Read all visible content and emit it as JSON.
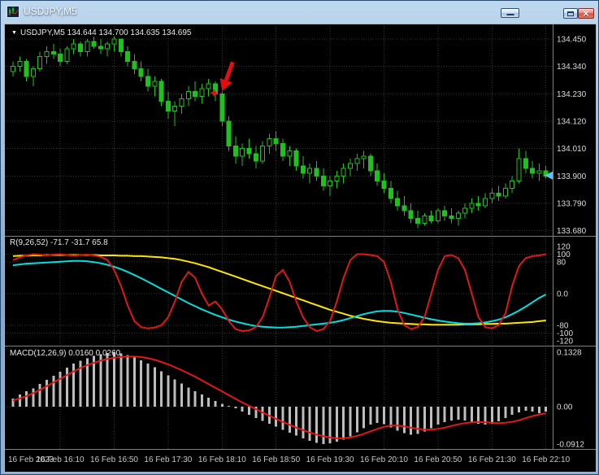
{
  "window": {
    "title": "USDJPY,M5"
  },
  "icons": {
    "close": "×",
    "dropdown": "▼"
  },
  "info": {
    "symbol": "USDJPY,M5",
    "ohlc": "134.644 134.700 134.635 134.695"
  },
  "indicators": {
    "middle_label": "R(9,26,52) -71.7 -31.7 65.8",
    "macd_label": "MACD(12,26,9) 0.0160 0.0260"
  },
  "axes": {
    "price": [
      "134.450",
      "134.340",
      "134.230",
      "134.120",
      "134.010",
      "133.900",
      "133.790",
      "133.680"
    ],
    "time": [
      "16 Feb 2023",
      "16 Feb 16:10",
      "16 Feb 16:50",
      "16 Feb 17:30",
      "16 Feb 18:10",
      "16 Feb 18:50",
      "16 Feb 19:30",
      "16 Feb 20:10",
      "16 Feb 20:50",
      "16 Feb 21:30",
      "16 Feb 22:10"
    ]
  },
  "colors": {
    "background": "#000000",
    "grid": "#383838",
    "divider": "#808080",
    "candle": "#20c020",
    "bull_body": "#000000",
    "red": "#e21717",
    "cyan": "#00dede",
    "yellow": "#ffe400",
    "histogram": "#bdbdbd",
    "axis_text": "#dcdcdc",
    "time_text": "#c8c8c8",
    "arrow": "#e01010",
    "price_marker": "#56c7f0"
  },
  "annotations": {
    "sell_arrow": {
      "bar": 31,
      "price": 134.24
    },
    "price_pointer": {
      "price": 133.902
    }
  },
  "chart_data": [
    {
      "type": "candlestick",
      "title": "USDJPY M5",
      "ylim": [
        133.66,
        134.49
      ],
      "ohlc": [
        [
          134.32,
          134.36,
          134.3,
          134.34
        ],
        [
          134.34,
          134.38,
          134.32,
          134.36
        ],
        [
          134.36,
          134.37,
          134.28,
          134.3
        ],
        [
          134.3,
          134.34,
          134.26,
          134.33
        ],
        [
          134.33,
          134.4,
          134.32,
          134.38
        ],
        [
          134.38,
          134.42,
          134.35,
          134.4
        ],
        [
          134.4,
          134.43,
          134.37,
          134.39
        ],
        [
          134.39,
          134.41,
          134.34,
          134.36
        ],
        [
          134.36,
          134.42,
          134.35,
          134.41
        ],
        [
          134.41,
          134.45,
          134.39,
          134.43
        ],
        [
          134.43,
          134.44,
          134.38,
          134.4
        ],
        [
          134.4,
          134.45,
          134.38,
          134.44
        ],
        [
          134.44,
          134.46,
          134.41,
          134.42
        ],
        [
          134.42,
          134.45,
          134.39,
          134.41
        ],
        [
          134.41,
          134.44,
          134.38,
          134.43
        ],
        [
          134.43,
          134.46,
          134.4,
          134.45
        ],
        [
          134.45,
          134.45,
          134.38,
          134.4
        ],
        [
          134.4,
          134.42,
          134.34,
          134.36
        ],
        [
          134.36,
          134.39,
          134.31,
          134.33
        ],
        [
          134.33,
          134.36,
          134.28,
          134.3
        ],
        [
          134.3,
          134.33,
          134.24,
          134.26
        ],
        [
          134.26,
          134.3,
          134.22,
          134.28
        ],
        [
          134.28,
          134.29,
          134.18,
          134.2
        ],
        [
          134.2,
          134.24,
          134.13,
          134.16
        ],
        [
          134.16,
          134.2,
          134.1,
          134.18
        ],
        [
          134.18,
          134.23,
          134.15,
          134.21
        ],
        [
          134.21,
          134.26,
          134.18,
          134.24
        ],
        [
          134.24,
          134.28,
          134.2,
          134.22
        ],
        [
          134.22,
          134.27,
          134.19,
          134.25
        ],
        [
          134.25,
          134.29,
          134.22,
          134.27
        ],
        [
          134.27,
          134.28,
          134.2,
          134.23
        ],
        [
          134.23,
          134.24,
          134.1,
          134.12
        ],
        [
          134.12,
          134.14,
          134.0,
          134.02
        ],
        [
          134.02,
          134.06,
          133.95,
          133.98
        ],
        [
          133.98,
          134.03,
          133.94,
          134.01
        ],
        [
          134.01,
          134.05,
          133.97,
          133.99
        ],
        [
          133.99,
          134.02,
          133.93,
          133.96
        ],
        [
          133.96,
          134.04,
          133.95,
          134.02
        ],
        [
          134.02,
          134.07,
          133.99,
          134.05
        ],
        [
          134.05,
          134.08,
          134.0,
          134.03
        ],
        [
          134.03,
          134.05,
          133.96,
          133.98
        ],
        [
          133.98,
          134.02,
          133.94,
          134.0
        ],
        [
          134.0,
          134.01,
          133.92,
          133.94
        ],
        [
          133.94,
          133.98,
          133.89,
          133.91
        ],
        [
          133.91,
          133.95,
          133.87,
          133.93
        ],
        [
          133.93,
          133.96,
          133.88,
          133.9
        ],
        [
          133.9,
          133.93,
          133.84,
          133.86
        ],
        [
          133.86,
          133.9,
          133.82,
          133.88
        ],
        [
          133.88,
          133.92,
          133.85,
          133.9
        ],
        [
          133.9,
          133.95,
          133.87,
          133.93
        ],
        [
          133.93,
          133.97,
          133.9,
          133.95
        ],
        [
          133.95,
          133.99,
          133.92,
          133.97
        ],
        [
          133.97,
          134.0,
          133.93,
          133.98
        ],
        [
          133.98,
          133.99,
          133.9,
          133.92
        ],
        [
          133.92,
          133.95,
          133.86,
          133.88
        ],
        [
          133.88,
          133.91,
          133.83,
          133.85
        ],
        [
          133.85,
          133.88,
          133.79,
          133.81
        ],
        [
          133.81,
          133.84,
          133.76,
          133.78
        ],
        [
          133.78,
          133.82,
          133.74,
          133.76
        ],
        [
          133.76,
          133.79,
          133.71,
          133.73
        ],
        [
          133.73,
          133.76,
          133.69,
          133.71
        ],
        [
          133.71,
          133.75,
          133.7,
          133.74
        ],
        [
          133.74,
          133.76,
          133.71,
          133.72
        ],
        [
          133.72,
          133.77,
          133.71,
          133.76
        ],
        [
          133.76,
          133.78,
          133.72,
          133.74
        ],
        [
          133.74,
          133.77,
          133.71,
          133.73
        ],
        [
          133.73,
          133.76,
          133.7,
          133.75
        ],
        [
          133.75,
          133.79,
          133.73,
          133.77
        ],
        [
          133.77,
          133.81,
          133.75,
          133.79
        ],
        [
          133.79,
          133.82,
          133.76,
          133.78
        ],
        [
          133.78,
          133.83,
          133.77,
          133.81
        ],
        [
          133.81,
          133.85,
          133.79,
          133.83
        ],
        [
          133.83,
          133.86,
          133.8,
          133.82
        ],
        [
          133.82,
          133.87,
          133.81,
          133.85
        ],
        [
          133.85,
          133.9,
          133.83,
          133.88
        ],
        [
          133.88,
          134.01,
          133.87,
          133.97
        ],
        [
          133.97,
          134.0,
          133.91,
          133.93
        ],
        [
          133.93,
          133.96,
          133.89,
          133.91
        ],
        [
          133.91,
          133.95,
          133.88,
          133.92
        ],
        [
          133.92,
          133.94,
          133.89,
          133.9
        ]
      ]
    },
    {
      "type": "line",
      "name": "R(9,26,52)",
      "ylim": [
        -130,
        130
      ],
      "grid": [
        100,
        80,
        0,
        -80,
        -100
      ],
      "axis": [
        "120",
        "100",
        "80",
        "0.0",
        "-80",
        "-100",
        "-120"
      ],
      "series": [
        {
          "name": "red",
          "values": [
            85,
            92,
            97,
            100,
            99,
            97,
            99,
            100,
            98,
            96,
            98,
            99,
            97,
            93,
            85,
            60,
            20,
            -30,
            -70,
            -85,
            -88,
            -86,
            -80,
            -60,
            -20,
            30,
            55,
            40,
            0,
            -30,
            -20,
            -40,
            -70,
            -90,
            -95,
            -93,
            -85,
            -60,
            -10,
            45,
            60,
            30,
            -20,
            -60,
            -85,
            -95,
            -90,
            -70,
            -20,
            40,
            85,
            100,
            100,
            98,
            95,
            80,
            30,
            -40,
            -80,
            -90,
            -85,
            -60,
            0,
            60,
            95,
            98,
            90,
            60,
            0,
            -60,
            -85,
            -88,
            -80,
            -50,
            20,
            70,
            90,
            95,
            97,
            100
          ]
        },
        {
          "name": "cyan",
          "values": [
            72,
            74,
            76,
            77,
            78,
            79,
            80,
            81,
            82,
            83,
            83,
            82,
            80,
            77,
            73,
            68,
            62,
            55,
            47,
            39,
            30,
            21,
            12,
            3,
            -6,
            -15,
            -24,
            -32,
            -40,
            -47,
            -54,
            -60,
            -66,
            -71,
            -75,
            -79,
            -82,
            -84,
            -85,
            -86,
            -86,
            -85,
            -84,
            -82,
            -80,
            -78,
            -76,
            -74,
            -71,
            -67,
            -62,
            -57,
            -52,
            -48,
            -45,
            -44,
            -44,
            -46,
            -49,
            -53,
            -57,
            -61,
            -65,
            -68,
            -71,
            -73,
            -75,
            -76,
            -76,
            -75,
            -73,
            -70,
            -66,
            -60,
            -52,
            -43,
            -33,
            -22,
            -11,
            -2
          ]
        },
        {
          "name": "yellow",
          "values": [
            95,
            96,
            96,
            97,
            97,
            98,
            98,
            98,
            98,
            98,
            98,
            98,
            98,
            97,
            97,
            97,
            96,
            96,
            95,
            95,
            94,
            93,
            92,
            90,
            88,
            85,
            81,
            77,
            72,
            67,
            61,
            55,
            49,
            43,
            37,
            31,
            25,
            19,
            13,
            7,
            1,
            -5,
            -11,
            -17,
            -23,
            -29,
            -35,
            -41,
            -46,
            -51,
            -56,
            -60,
            -64,
            -67,
            -70,
            -72,
            -74,
            -75,
            -76,
            -77,
            -78,
            -78,
            -79,
            -79,
            -79,
            -79,
            -79,
            -78,
            -78,
            -78,
            -77,
            -77,
            -76,
            -76,
            -75,
            -74,
            -73,
            -72,
            -70,
            -68
          ]
        }
      ]
    },
    {
      "type": "bar",
      "name": "MACD(12,26,9)",
      "ylim": [
        -0.105,
        0.145
      ],
      "axis": [
        "0.1328",
        "0.00",
        "-0.0912"
      ],
      "histogram": [
        0.02,
        0.03,
        0.038,
        0.045,
        0.055,
        0.065,
        0.075,
        0.085,
        0.095,
        0.105,
        0.112,
        0.118,
        0.124,
        0.128,
        0.131,
        0.133,
        0.13,
        0.126,
        0.12,
        0.113,
        0.105,
        0.096,
        0.086,
        0.076,
        0.066,
        0.056,
        0.047,
        0.038,
        0.03,
        0.022,
        0.014,
        0.007,
        0.002,
        -0.004,
        -0.012,
        -0.02,
        -0.028,
        -0.035,
        -0.042,
        -0.049,
        -0.056,
        -0.063,
        -0.07,
        -0.077,
        -0.083,
        -0.088,
        -0.091,
        -0.089,
        -0.085,
        -0.08,
        -0.072,
        -0.062,
        -0.052,
        -0.044,
        -0.04,
        -0.043,
        -0.05,
        -0.058,
        -0.064,
        -0.068,
        -0.066,
        -0.06,
        -0.052,
        -0.044,
        -0.038,
        -0.034,
        -0.032,
        -0.034,
        -0.038,
        -0.042,
        -0.044,
        -0.042,
        -0.036,
        -0.028,
        -0.02,
        -0.014,
        -0.01,
        -0.012,
        -0.016,
        -0.012
      ],
      "signal": [
        0.015,
        0.02,
        0.026,
        0.033,
        0.041,
        0.05,
        0.059,
        0.068,
        0.077,
        0.086,
        0.094,
        0.101,
        0.107,
        0.112,
        0.116,
        0.119,
        0.121,
        0.122,
        0.122,
        0.121,
        0.118,
        0.114,
        0.109,
        0.103,
        0.096,
        0.089,
        0.081,
        0.073,
        0.064,
        0.055,
        0.046,
        0.037,
        0.028,
        0.019,
        0.01,
        0.002,
        -0.006,
        -0.014,
        -0.022,
        -0.03,
        -0.037,
        -0.044,
        -0.051,
        -0.057,
        -0.063,
        -0.068,
        -0.072,
        -0.075,
        -0.077,
        -0.077,
        -0.075,
        -0.071,
        -0.066,
        -0.06,
        -0.054,
        -0.049,
        -0.046,
        -0.046,
        -0.048,
        -0.051,
        -0.054,
        -0.056,
        -0.056,
        -0.054,
        -0.051,
        -0.047,
        -0.043,
        -0.04,
        -0.038,
        -0.037,
        -0.038,
        -0.039,
        -0.04,
        -0.039,
        -0.037,
        -0.033,
        -0.028,
        -0.023,
        -0.019,
        -0.016
      ]
    }
  ]
}
